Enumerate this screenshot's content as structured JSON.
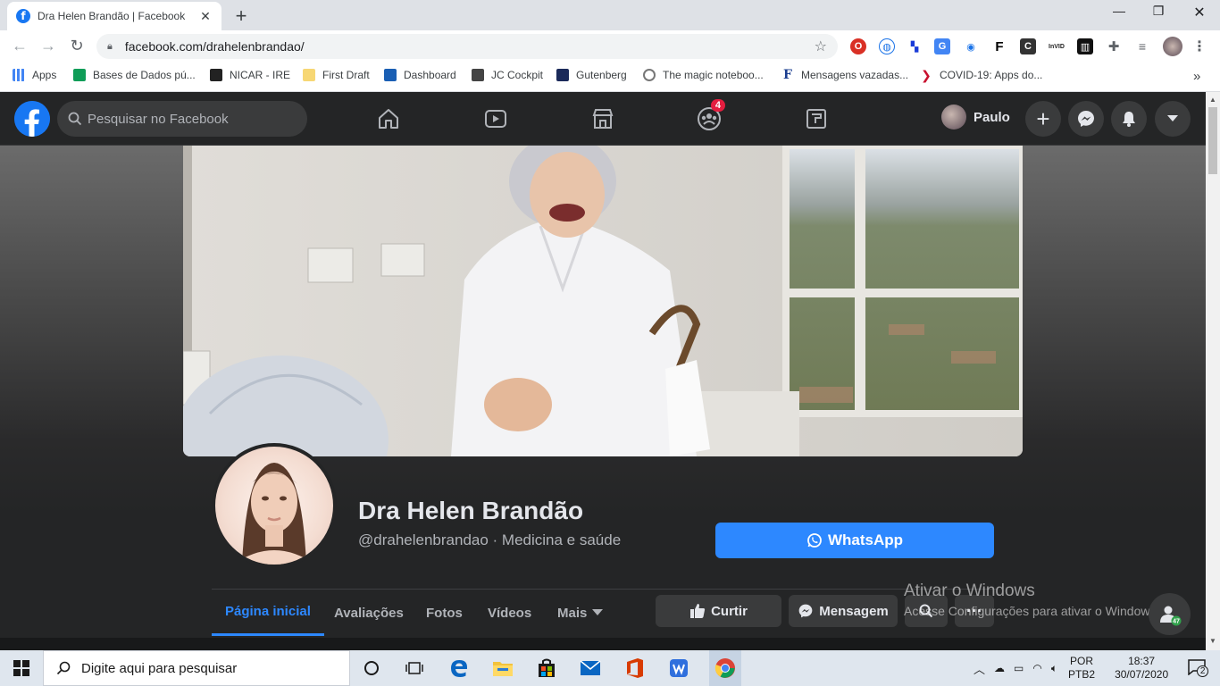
{
  "browser": {
    "tab_title": "Dra Helen Brandão | Facebook",
    "tab_favicon": "f",
    "url": "facebook.com/drahelenbrandao/",
    "bookmarks": [
      {
        "label": "Apps",
        "icon": "apps-grid-icon",
        "color": "#4285f4"
      },
      {
        "label": "Bases de Dados pú...",
        "icon": "sheets-icon",
        "color": "#0f9d58"
      },
      {
        "label": "NICAR - IRE",
        "icon": "ire-icon",
        "color": "#222222"
      },
      {
        "label": "First Draft",
        "icon": "folder-icon",
        "color": "#f7d774"
      },
      {
        "label": "Dashboard",
        "icon": "ie-icon",
        "color": "#1a5fb4"
      },
      {
        "label": "JC Cockpit",
        "icon": "jc-icon",
        "color": "#444444"
      },
      {
        "label": "Gutenberg",
        "icon": "gutenberg-icon",
        "color": "#1b2a5a"
      },
      {
        "label": "The magic noteboo...",
        "icon": "clock-icon",
        "color": "#777777"
      },
      {
        "label": "Mensagens vazadas...",
        "icon": "f-serif-icon",
        "color": "#1a3d8f"
      },
      {
        "label": "COVID-19: Apps do...",
        "icon": "chevron-red-icon",
        "color": "#c8102e"
      }
    ],
    "overflow": "»"
  },
  "facebook": {
    "search_placeholder": "Pesquisar no Facebook",
    "groups_badge": "4",
    "profile_name": "Paulo",
    "page": {
      "name": "Dra Helen Brandão",
      "subtitle": "@drahelenbrandao · Medicina e saúde",
      "whatsapp_label": "WhatsApp"
    },
    "tabs": [
      {
        "label": "Página inicial",
        "active": true
      },
      {
        "label": "Avaliações",
        "active": false
      },
      {
        "label": "Fotos",
        "active": false
      },
      {
        "label": "Vídeos",
        "active": false
      },
      {
        "label": "Mais",
        "active": false
      }
    ],
    "actions": {
      "like": "Curtir",
      "message": "Mensagem"
    },
    "contacts_badge": "47",
    "accent": "#2d88ff"
  },
  "watermark": {
    "line1": "Ativar o Windows",
    "line2": "Acesse Configurações para ativar o Windows."
  },
  "taskbar": {
    "search_placeholder": "Digite aqui para pesquisar",
    "lang1": "POR",
    "lang2": "PTB2",
    "time": "18:37",
    "date": "30/07/2020",
    "notifications": "2"
  }
}
